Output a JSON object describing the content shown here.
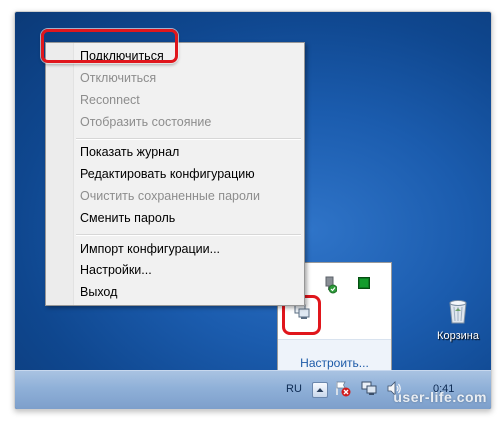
{
  "context_menu": {
    "groups": [
      [
        {
          "label": "Подключиться",
          "enabled": true
        },
        {
          "label": "Отключиться",
          "enabled": false
        },
        {
          "label": "Reconnect",
          "enabled": false
        },
        {
          "label": "Отобразить состояние",
          "enabled": false
        }
      ],
      [
        {
          "label": "Показать журнал",
          "enabled": true
        },
        {
          "label": "Редактировать конфигурацию",
          "enabled": true
        },
        {
          "label": "Очистить сохраненные пароли",
          "enabled": false
        },
        {
          "label": "Сменить пароль",
          "enabled": true
        }
      ],
      [
        {
          "label": "Импорт конфигурации...",
          "enabled": true
        },
        {
          "label": "Настройки...",
          "enabled": true
        },
        {
          "label": "Выход",
          "enabled": true
        }
      ]
    ],
    "highlighted_item": "Подключиться"
  },
  "tray_popup": {
    "icons": [
      "usb-device-check-icon",
      "green-square-icon",
      "openvpn-tray-icon"
    ],
    "customize_label": "Настроить..."
  },
  "desktop": {
    "recycle_bin_label": "Корзина"
  },
  "taskbar": {
    "language": "RU",
    "clock": "0:41",
    "tray_icons": [
      "show-hidden-icons-button",
      "action-center-flag-icon",
      "network-icon",
      "volume-icon"
    ]
  },
  "colors": {
    "highlight_outline": "#e0161c",
    "desktop_blue": "#1b5cae",
    "link_blue": "#1c5aa8"
  },
  "watermark": "user-life.com"
}
